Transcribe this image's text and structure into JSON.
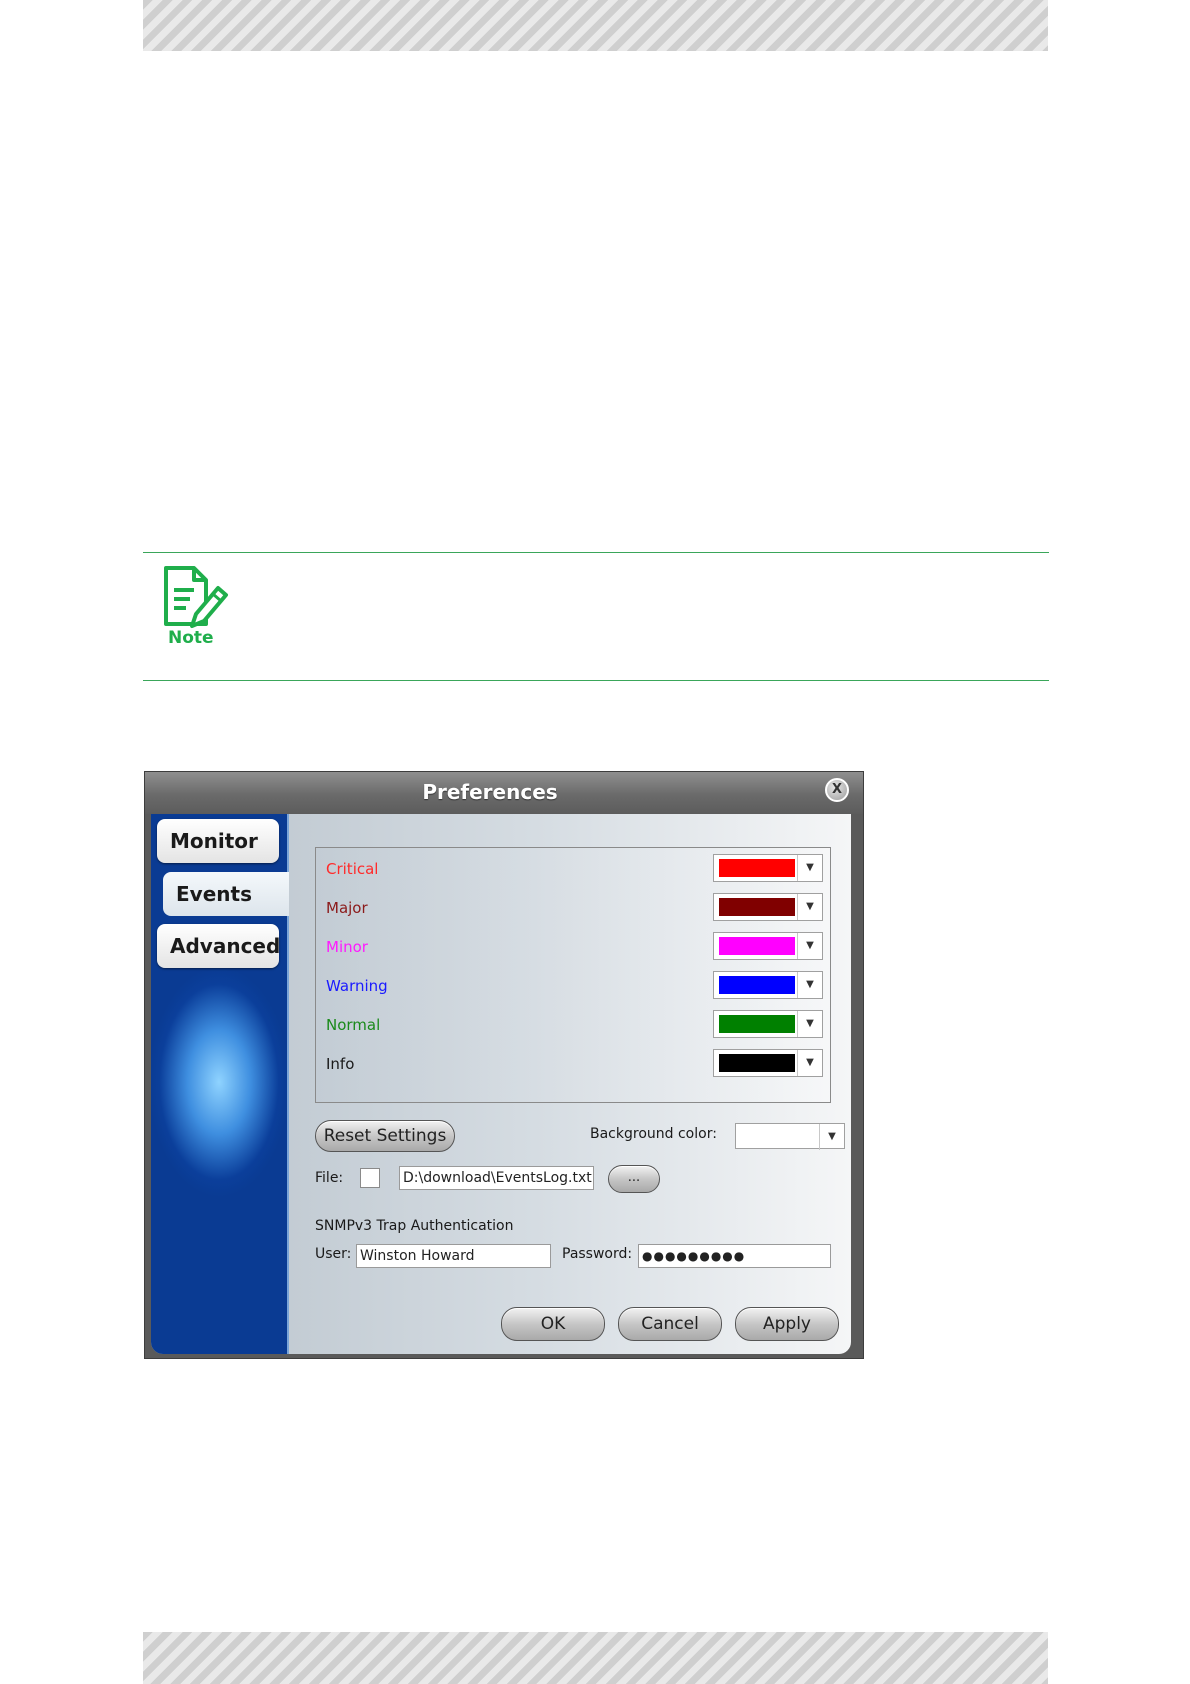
{
  "note": {
    "label": "Note"
  },
  "dialog": {
    "title": "Preferences",
    "close_label": "X",
    "tabs": [
      {
        "label": "Monitor",
        "active": false
      },
      {
        "label": "Events",
        "active": true
      },
      {
        "label": "Advanced",
        "active": false
      }
    ],
    "severities": [
      {
        "label": "Critical",
        "color": "#ff0000",
        "text_color": "#ff2a2a"
      },
      {
        "label": "Major",
        "color": "#800000",
        "text_color": "#8b1a1a"
      },
      {
        "label": "Minor",
        "color": "#ff00ff",
        "text_color": "#ff1aff"
      },
      {
        "label": "Warning",
        "color": "#0000ff",
        "text_color": "#1a1aff"
      },
      {
        "label": "Normal",
        "color": "#008000",
        "text_color": "#1a8a1a"
      },
      {
        "label": "Info",
        "color": "#000000",
        "text_color": "#1a1a1a"
      }
    ],
    "reset_button": "Reset Settings",
    "background_color_label": "Background color:",
    "file_label": "File:",
    "file_path": "D:\\download\\EventsLog.txt",
    "browse_button": "...",
    "snmp_heading": "SNMPv3 Trap Authentication",
    "user_label": "User:",
    "user_value": "Winston Howard",
    "password_label": "Password:",
    "password_value": "●●●●●●●●●",
    "ok_button": "OK",
    "cancel_button": "Cancel",
    "apply_button": "Apply"
  }
}
